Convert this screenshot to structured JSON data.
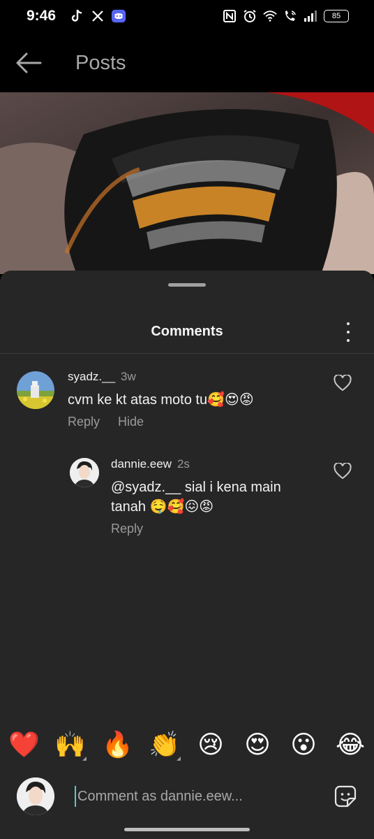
{
  "status_bar": {
    "time": "9:46",
    "battery": "85",
    "left_icons": [
      "tiktok-icon",
      "x-icon",
      "discord-icon"
    ],
    "right_icons": [
      "nfc-icon",
      "alarm-icon",
      "wifi-icon",
      "wifi-calling-icon",
      "signal-icon",
      "battery-icon"
    ]
  },
  "header": {
    "title": "Posts"
  },
  "sheet": {
    "title": "Comments"
  },
  "comments": [
    {
      "username": "syadz.__",
      "time": "3w",
      "text": "cvm ke kt atas moto tu🥰😍😡",
      "actions": {
        "reply": "Reply",
        "hide": "Hide"
      }
    },
    {
      "username": "dannie.eew",
      "time": "2s",
      "text_line1": "@syadz.__ sial i kena main",
      "text_line2": "tanah 🤤🥰😖😡",
      "actions": {
        "reply": "Reply"
      }
    }
  ],
  "emoji_reactions": [
    "❤️",
    "🙌",
    "🔥",
    "👏",
    "😢",
    "😍",
    "😮",
    "😂"
  ],
  "input": {
    "placeholder": "Comment as dannie.eew..."
  },
  "colors": {
    "sheet_bg": "#262626",
    "secondary_text": "#9a9a9a",
    "caret": "#5ec8c8"
  }
}
